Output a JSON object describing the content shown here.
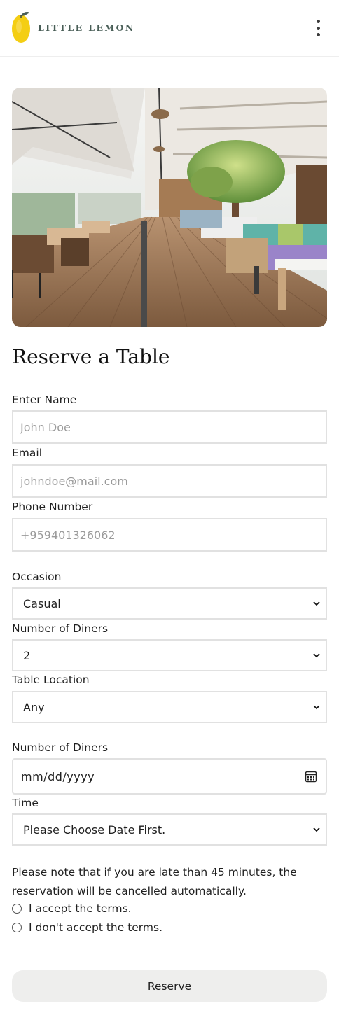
{
  "header": {
    "brand": "LITTLE LEMON",
    "logo_icon": "lemon-icon",
    "menu_icon": "kebab-menu-icon"
  },
  "page": {
    "title": "Reserve a Table"
  },
  "form": {
    "name": {
      "label": "Enter Name",
      "placeholder": "John Doe"
    },
    "email": {
      "label": "Email",
      "placeholder": "johndoe@mail.com"
    },
    "phone": {
      "label": "Phone Number",
      "placeholder": "+959401326062"
    },
    "occasion": {
      "label": "Occasion",
      "value": "Casual"
    },
    "diners": {
      "label": "Number of Diners",
      "value": "2"
    },
    "location": {
      "label": "Table Location",
      "value": "Any"
    },
    "date": {
      "label": "Number of Diners",
      "value": "mm/dd/yyyy"
    },
    "time": {
      "label": "Time",
      "value": "Please Choose Date First."
    }
  },
  "note": "Please note that if you are late than 45 minutes, the reservation will be cancelled automatically.",
  "terms": {
    "accept": "I accept the terms.",
    "decline": "I don't accept the terms."
  },
  "submit_label": "Reserve",
  "colors": {
    "brand_green": "#495e57",
    "lemon_yellow": "#f4ce14",
    "button_bg": "#eeeeed"
  }
}
